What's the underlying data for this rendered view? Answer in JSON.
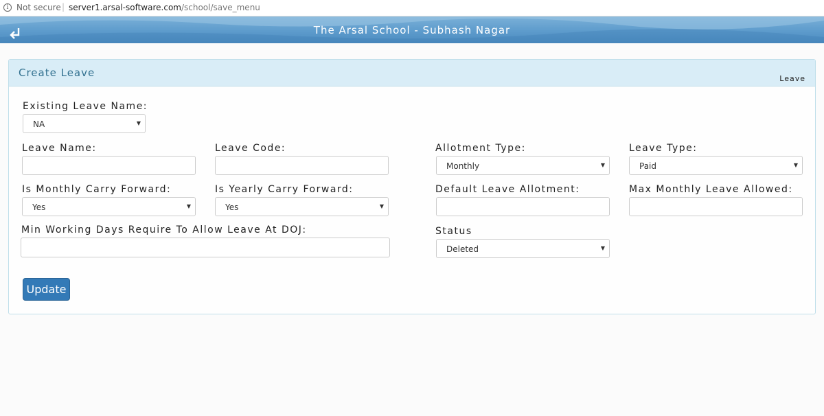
{
  "browser": {
    "secure_label": "Not secure",
    "url_host": "server1.arsal-software.com",
    "url_path": "/school/save_menu"
  },
  "header": {
    "title": "The Arsal School - Subhash Nagar",
    "back_icon": "return-arrow-icon"
  },
  "panel": {
    "title": "Create Leave",
    "breadcrumb": "Leave"
  },
  "form": {
    "existing_leave_name": {
      "label": "Existing Leave Name:",
      "value": "NA"
    },
    "leave_name": {
      "label": "Leave Name:",
      "value": ""
    },
    "leave_code": {
      "label": "Leave Code:",
      "value": ""
    },
    "allotment_type": {
      "label": "Allotment Type:",
      "value": "Monthly"
    },
    "leave_type": {
      "label": "Leave Type:",
      "value": "Paid"
    },
    "monthly_carry_forward": {
      "label": "Is Monthly Carry Forward:",
      "value": "Yes"
    },
    "yearly_carry_forward": {
      "label": "Is Yearly Carry Forward:",
      "value": "Yes"
    },
    "default_leave_allotment": {
      "label": "Default Leave Allotment:",
      "value": ""
    },
    "max_monthly_leave": {
      "label": "Max Monthly Leave Allowed:",
      "value": ""
    },
    "min_working_days": {
      "label": "Min Working Days Require To Allow Leave At DOJ:",
      "value": ""
    },
    "status": {
      "label": "Status",
      "value": "Deleted"
    },
    "submit_label": "Update"
  }
}
